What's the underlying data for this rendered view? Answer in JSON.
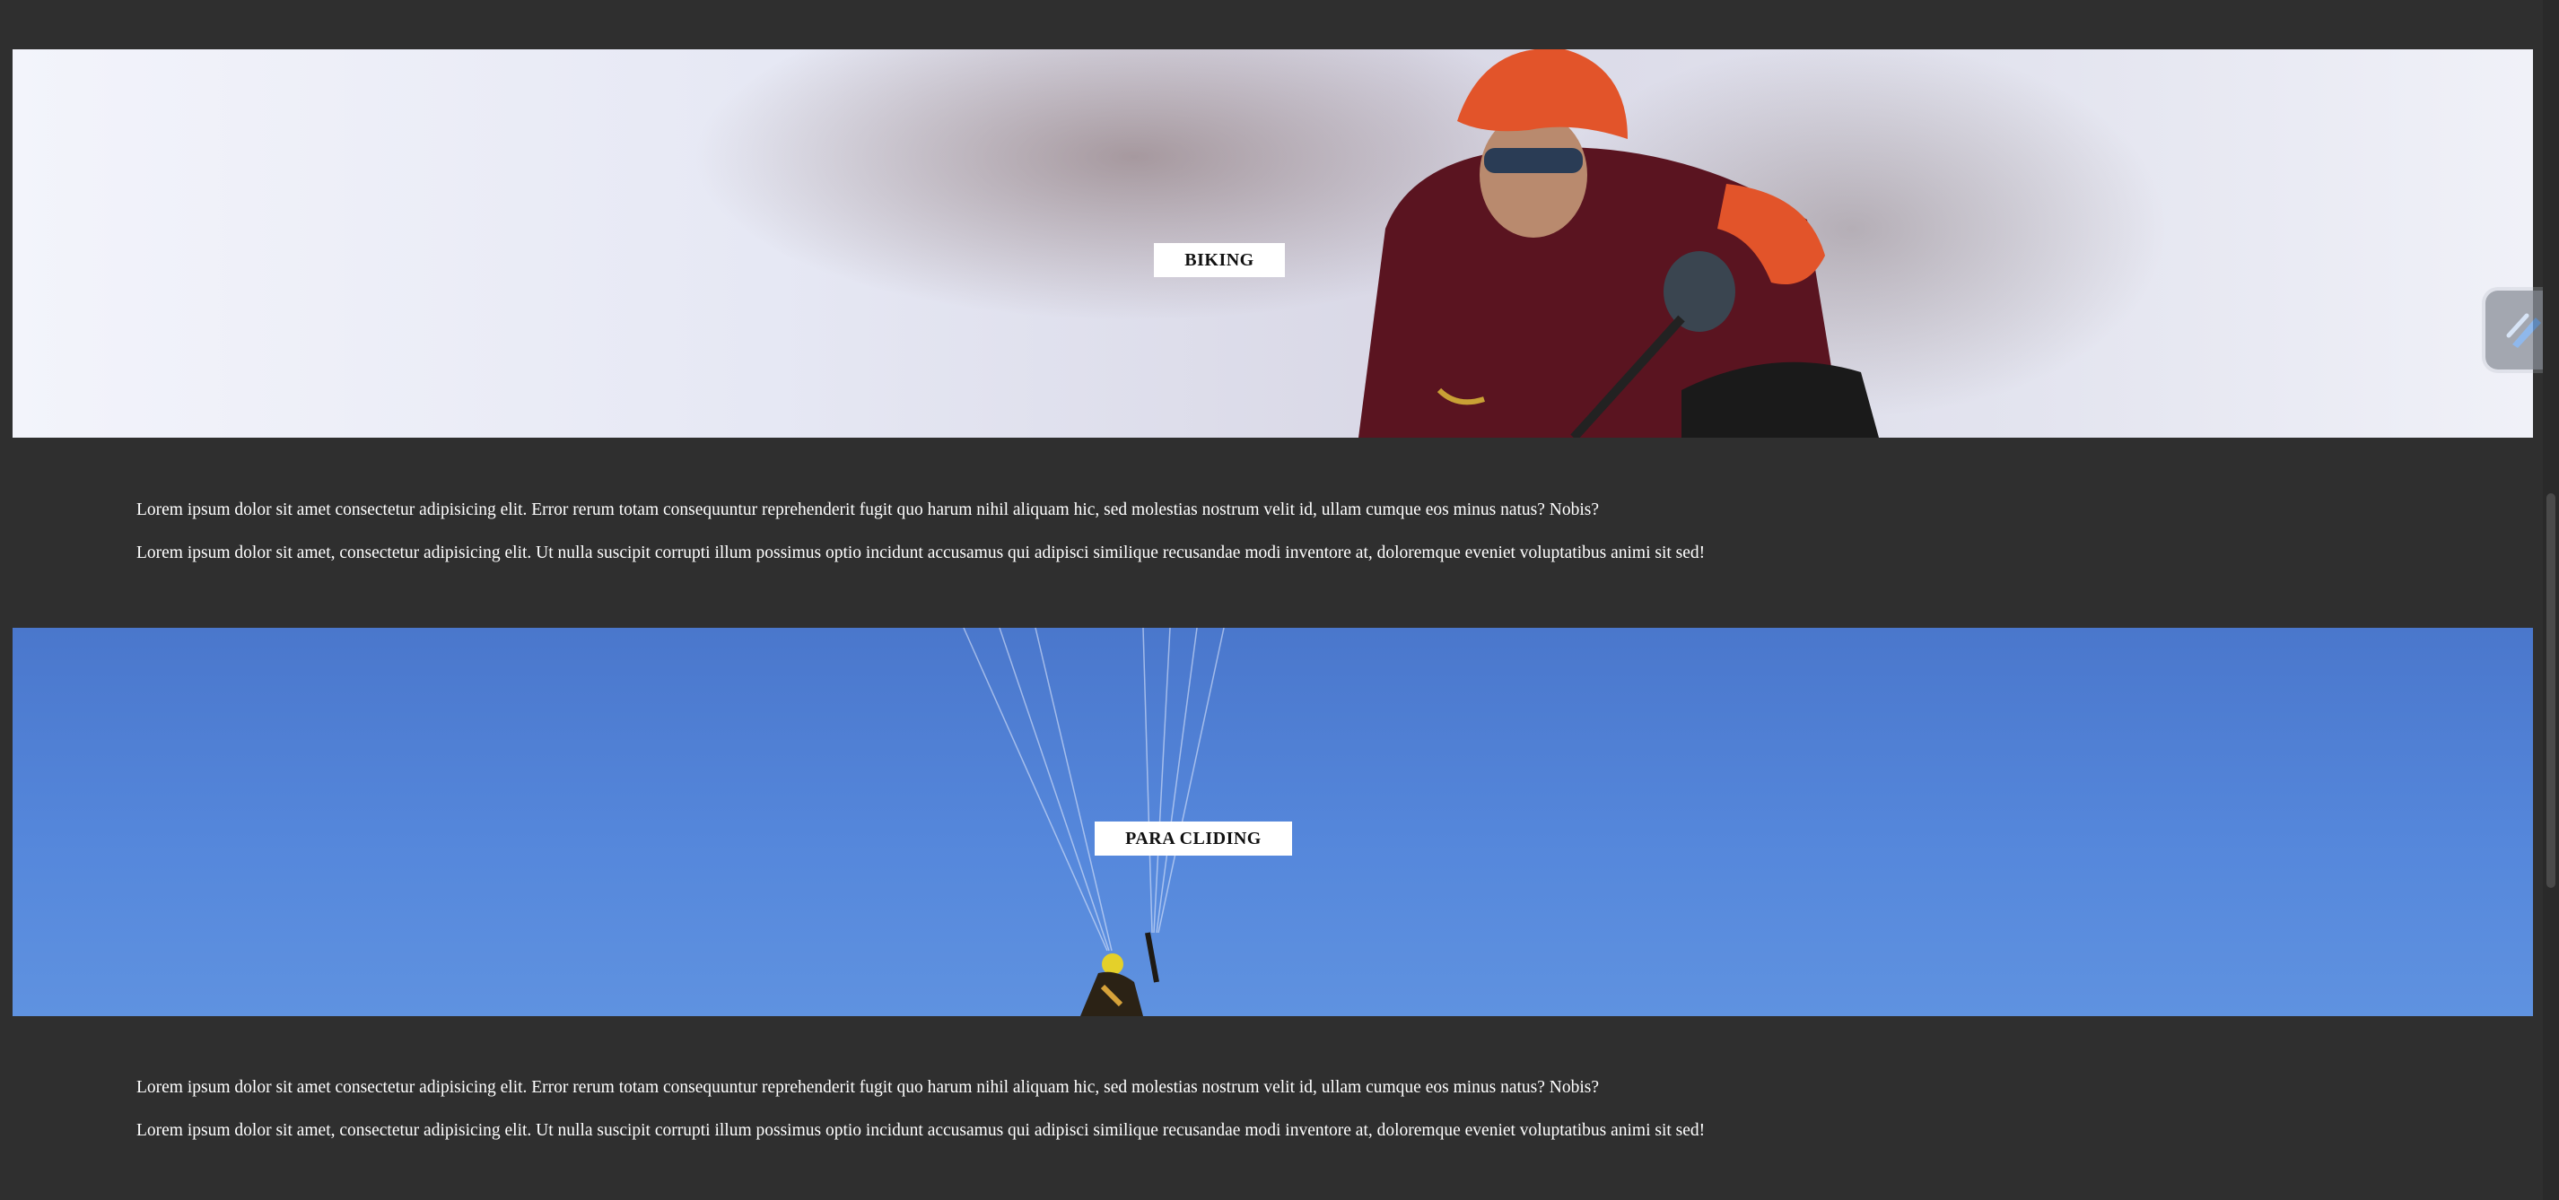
{
  "sections": [
    {
      "label": "BIKING",
      "paragraphs": [
        "Lorem ipsum dolor sit amet consectetur adipisicing elit. Error rerum totam consequuntur reprehenderit fugit quo harum nihil aliquam hic, sed molestias nostrum velit id, ullam cumque eos minus natus? Nobis?",
        "Lorem ipsum dolor sit amet, consectetur adipisicing elit. Ut nulla suscipit corrupti illum possimus optio incidunt accusamus qui adipisci similique recusandae modi inventore at, doloremque eveniet voluptatibus animi sit sed!"
      ]
    },
    {
      "label": "PARA CLIDING",
      "paragraphs": [
        "Lorem ipsum dolor sit amet consectetur adipisicing elit. Error rerum totam consequuntur reprehenderit fugit quo harum nihil aliquam hic, sed molestias nostrum velit id, ullam cumque eos minus natus? Nobis?",
        "Lorem ipsum dolor sit amet, consectetur adipisicing elit. Ut nulla suscipit corrupti illum possimus optio incidunt accusamus qui adipisci similique recusandae modi inventore at, doloremque eveniet voluptatibus animi sit sed!"
      ]
    }
  ],
  "icons": {
    "floating_tool": "pen-tool-icon"
  },
  "colors": {
    "page_background": "#2f2f2f",
    "sky_blue": "#5587db",
    "label_background": "#ffffff"
  }
}
